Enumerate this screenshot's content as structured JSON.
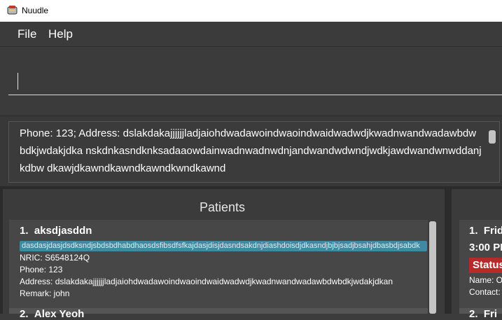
{
  "window": {
    "title": "Nuudle"
  },
  "menu": {
    "file": "File",
    "help": "Help"
  },
  "command": {
    "value": ""
  },
  "result": {
    "text": "Phone: 123; Address: dslakdakajjjjjjladjaiohdwadawoindwaoindwaidwadwdjkwadnwandwadawbdwbdkjwdakjdka nskdnkasndknksadaaowdainwadnwadnwdnjandwandwdwndjwdkjawdwandwnwddanjkdbw dkawjdkawndkawndkawndkwndkawnd"
  },
  "patients": {
    "title": "Patients",
    "list": [
      {
        "index": "1.",
        "name": "aksdjasddn",
        "tag": "dasdasjdasjdsdksndjsbdsbdhabdhaosdsfibsdfsfkajdasjdisjdasndsakdnjdiashdoisdjdkasndjbjbjsadjbsahjdbasbdjsabdk",
        "nric": "NRIC: S6548124Q",
        "phone": "Phone: 123",
        "address": "Address: dslakdakajjjjjjladjaiohdwadawoindwaoindwaidwadwdjkwadnwandwadawbdwbdkjwdakjdkan",
        "remark": "Remark: john"
      },
      {
        "index": "2.",
        "name": "Alex Yeoh"
      }
    ]
  },
  "appointments": {
    "list": [
      {
        "index": "1.",
        "day": "Frid",
        "time": "3:00 PI",
        "status": "Status",
        "name": "Name: O",
        "contact": "Contact:"
      },
      {
        "index": "2.",
        "day": "Fri"
      }
    ]
  }
}
